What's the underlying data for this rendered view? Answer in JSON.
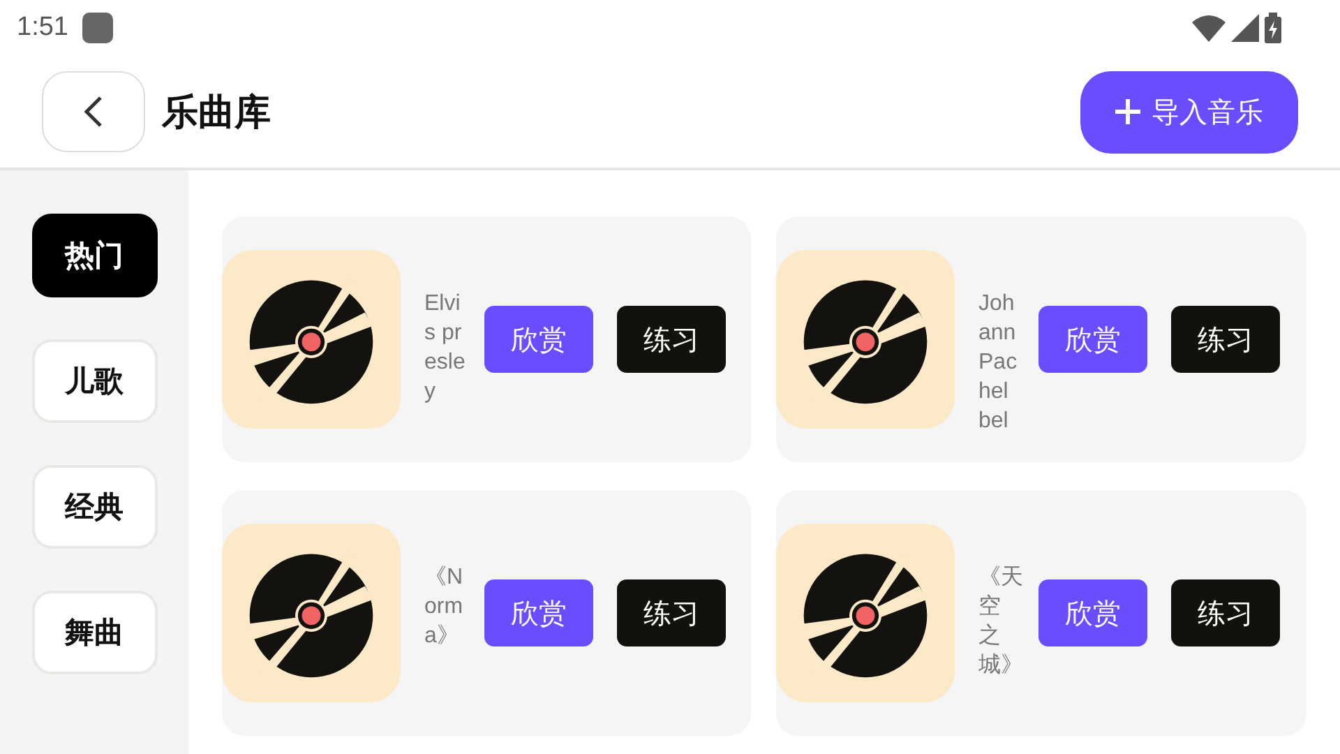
{
  "status_bar": {
    "time": "1:51"
  },
  "header": {
    "title": "乐曲库",
    "import_button": "导入音乐"
  },
  "categories": [
    {
      "label": "热门",
      "selected": true
    },
    {
      "label": "儿歌",
      "selected": false
    },
    {
      "label": "经典",
      "selected": false
    },
    {
      "label": "舞曲",
      "selected": false
    }
  ],
  "songs": [
    {
      "title": "Elvis presley",
      "listen_button": "欣赏",
      "practice_button": "练习"
    },
    {
      "title": "Johann Pachelbel",
      "listen_button": "欣赏",
      "practice_button": "练习"
    },
    {
      "title": "《Norma》",
      "listen_button": "欣赏",
      "practice_button": "练习"
    },
    {
      "title": "《天空之城》",
      "listen_button": "欣赏",
      "practice_button": "练习"
    }
  ]
}
